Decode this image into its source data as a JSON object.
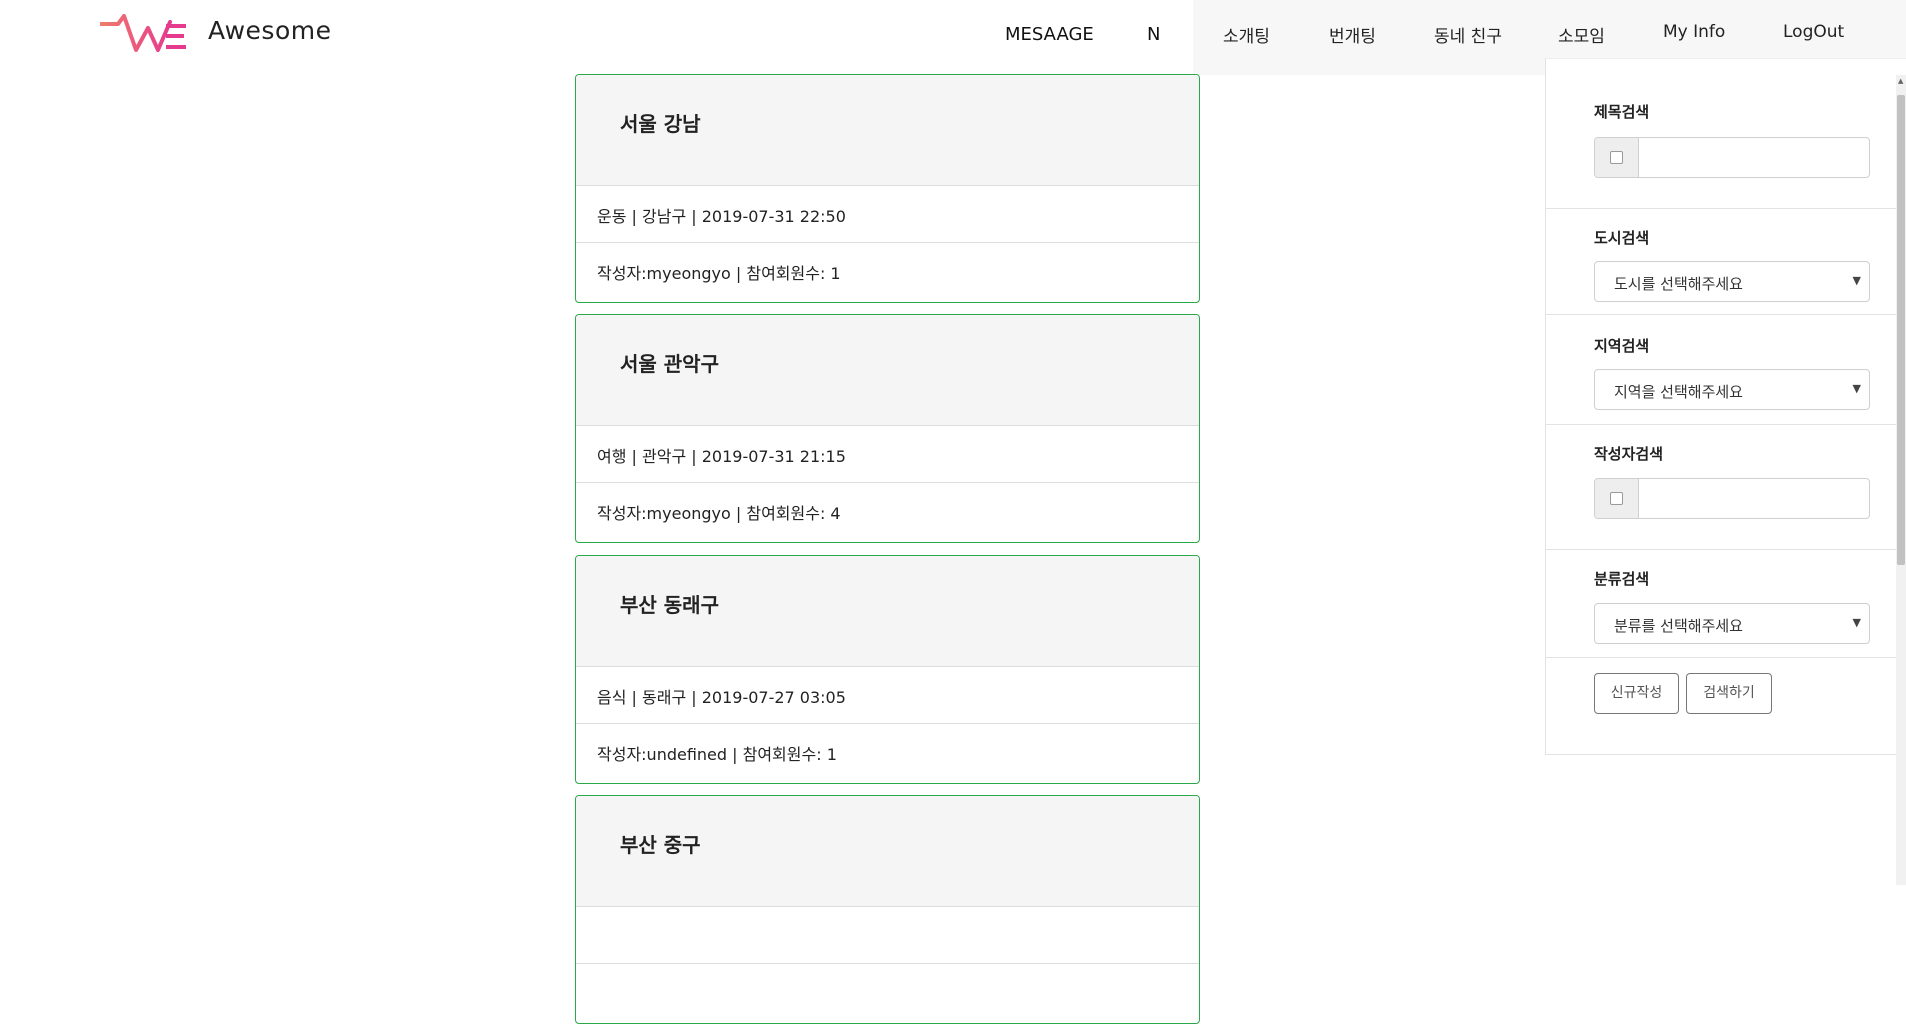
{
  "header": {
    "brand": "Awesome",
    "logo_icon": "awe-logo-icon",
    "message_label": "MESAAGE",
    "message_badge": "N",
    "nav": [
      "소개팅",
      "번개팅",
      "동네 친구",
      "소모임",
      "My Info",
      "LogOut"
    ]
  },
  "posts": [
    {
      "title": "서울 강남",
      "meta": "운동 | 강남구 | 2019-07-31 22:50",
      "info": "작성자:myeongyo | 참여회원수: 1"
    },
    {
      "title": "서울 관악구",
      "meta": "여행 | 관악구 | 2019-07-31 21:15",
      "info": "작성자:myeongyo | 참여회원수: 4"
    },
    {
      "title": "부산 동래구",
      "meta": "음식 | 동래구 | 2019-07-27 03:05",
      "info": "작성자:undefined | 참여회원수: 1"
    },
    {
      "title": "부산 중구",
      "meta": "",
      "info": ""
    }
  ],
  "sidebar": {
    "title_search_label": "제목검색",
    "title_search_value": "",
    "city_search_label": "도시검색",
    "city_select": "도시를 선택해주세요",
    "region_search_label": "지역검색",
    "region_select": "지역을 선택해주세요",
    "author_search_label": "작성자검색",
    "author_search_value": "",
    "category_search_label": "분류검색",
    "category_select": "분류를 선택해주세요",
    "new_post_button": "신규작성",
    "search_button": "검색하기"
  },
  "colors": {
    "card_border": "#2aa84a",
    "logo_gradient_start": "#f07b6a",
    "logo_gradient_end": "#e63a8e",
    "nav_bar_bg": "#f7f7f8"
  }
}
